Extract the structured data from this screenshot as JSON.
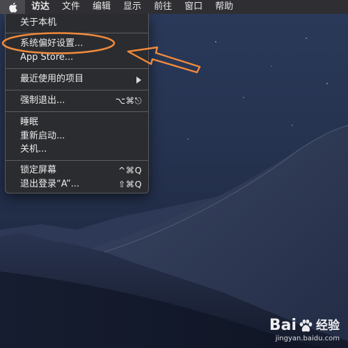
{
  "menubar": {
    "apple_icon": "apple-logo-icon",
    "menus": [
      "访达",
      "文件",
      "编辑",
      "显示",
      "前往",
      "窗口",
      "帮助"
    ]
  },
  "apple_menu": {
    "items": [
      {
        "label": "关于本机",
        "shortcut": ""
      },
      {
        "label": "系统偏好设置...",
        "shortcut": ""
      },
      {
        "label": "App Store...",
        "shortcut": ""
      },
      {
        "label": "最近使用的项目",
        "shortcut": ""
      },
      {
        "label": "强制退出...",
        "shortcut": "⌥⌘⎋"
      },
      {
        "label": "睡眠",
        "shortcut": ""
      },
      {
        "label": "重新启动...",
        "shortcut": ""
      },
      {
        "label": "关机...",
        "shortcut": ""
      },
      {
        "label": "锁定屏幕",
        "shortcut": "^⌘Q"
      },
      {
        "label": "退出登录“A”...",
        "shortcut": "⇧⌘Q"
      }
    ]
  },
  "annotation": {
    "color": "#f08a3c"
  },
  "watermark": {
    "brand": "Bai",
    "brand_suffix": "经验",
    "url": "jingyan.baidu.com"
  },
  "colors": {
    "menubar_bg": "#2f2f33",
    "menu_bg": "#2c2c2e",
    "desktop_sky": "#1d2740",
    "annotation_orange": "#f08a3c"
  }
}
